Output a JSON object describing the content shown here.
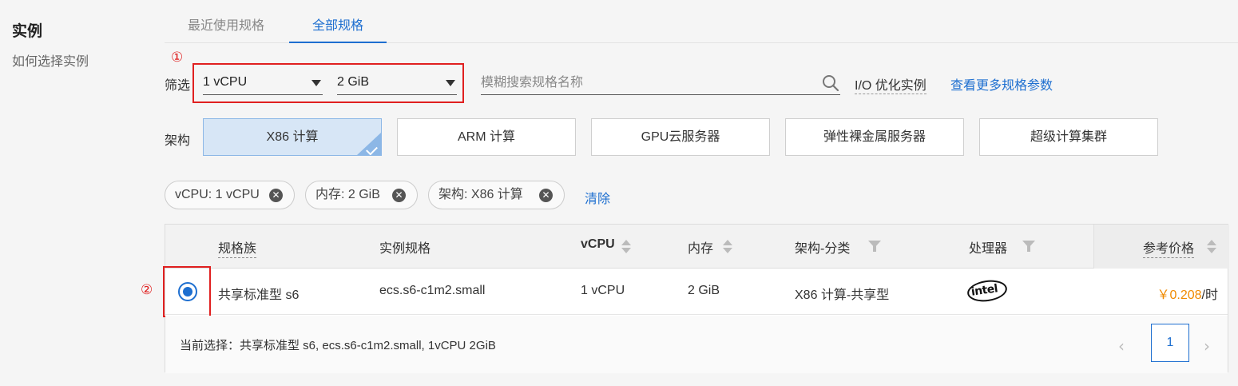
{
  "section": {
    "title": "实例",
    "subtitle": "如何选择实例"
  },
  "tabs": [
    {
      "label": "最近使用规格",
      "active": false
    },
    {
      "label": "全部规格",
      "active": true
    }
  ],
  "annotations": {
    "marker1": "①",
    "marker2": "②",
    "color": "#e02020"
  },
  "filter": {
    "label": "筛选",
    "vcpu_value": "1 vCPU",
    "memory_value": "2 GiB",
    "search_placeholder": "模糊搜索规格名称",
    "io_label": "I/O 优化实例",
    "more_link": "查看更多规格参数"
  },
  "architecture": {
    "label": "架构",
    "options": [
      {
        "label": "X86 计算",
        "selected": true
      },
      {
        "label": "ARM 计算",
        "selected": false
      },
      {
        "label": "GPU云服务器",
        "selected": false
      },
      {
        "label": "弹性裸金属服务器",
        "selected": false
      },
      {
        "label": "超级计算集群",
        "selected": false
      }
    ]
  },
  "chips": [
    {
      "label": "vCPU: 1 vCPU"
    },
    {
      "label": "内存: 2 GiB"
    },
    {
      "label": "架构: X86 计算"
    }
  ],
  "chip_remove_glyph": "✕",
  "clear_label": "清除",
  "table": {
    "headers": {
      "family": "规格族",
      "spec": "实例规格",
      "vcpu": "vCPU",
      "memory": "内存",
      "arch": "架构-分类",
      "processor": "处理器",
      "price": "参考价格"
    },
    "rows": [
      {
        "selected": true,
        "family": "共享标准型 s6",
        "spec": "ecs.s6-c1m2.small",
        "vcpu": "1 vCPU",
        "memory": "2 GiB",
        "arch": "X86 计算-共享型",
        "processor_logo": "intel",
        "price": "￥0.208",
        "price_unit": "/时"
      }
    ],
    "current_selection": "当前选择：共享标准型 s6, ecs.s6-c1m2.small, 1vCPU 2GiB"
  },
  "pagination": {
    "prev": "‹",
    "current": "1",
    "next": "›"
  },
  "colors": {
    "accent": "#1e6fd0",
    "price": "#f08a00",
    "selected_bg": "#d7e6f6"
  }
}
